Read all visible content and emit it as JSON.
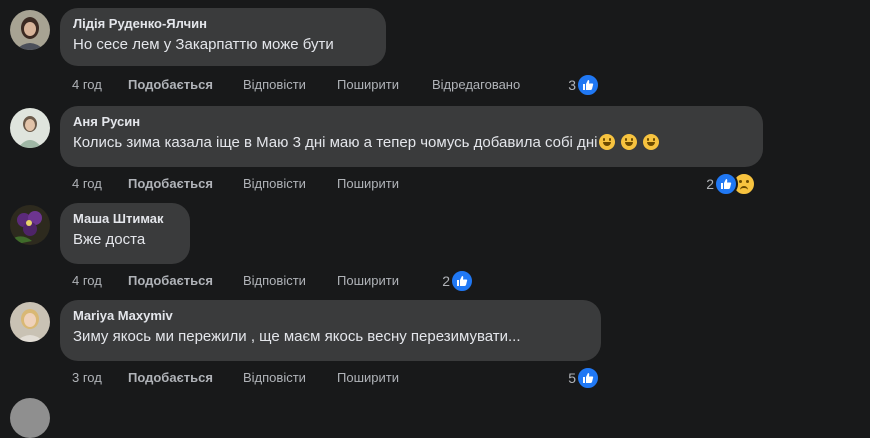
{
  "comments": [
    {
      "author": "Лідія Руденко-Ялчин",
      "text": "Но сесе лем у Закарпаттю може бути",
      "emojis": [],
      "time": "4 год",
      "like": "Подобається",
      "reply": "Відповісти",
      "share": "Поширити",
      "edited": "Відредаговано",
      "reaction_count": "3",
      "reactions": [
        "like-icon"
      ]
    },
    {
      "author": "Аня Русин",
      "text": "Колись зима казала іще в Маю 3 дні маю а тепер чомусь добавила собі дні",
      "emojis": [
        "grinning-emoji",
        "grinning-emoji",
        "grinning-emoji"
      ],
      "time": "4 год",
      "like": "Подобається",
      "reply": "Відповісти",
      "share": "Поширити",
      "reaction_count": "2",
      "reactions": [
        "like-icon",
        "sad-icon"
      ]
    },
    {
      "author": "Маша Штимак",
      "text": "Вже доста",
      "emojis": [],
      "time": "4 год",
      "like": "Подобається",
      "reply": "Відповісти",
      "share": "Поширити",
      "reaction_count": "2",
      "reactions": [
        "like-icon"
      ]
    },
    {
      "author": "Mariya Maxymiv",
      "text": "Зиму якось ми пережили , ще маєм якось весну перезимувати...",
      "emojis": [],
      "time": "3 год",
      "like": "Подобається",
      "reply": "Відповісти",
      "share": "Поширити",
      "reaction_count": "5",
      "reactions": [
        "like-icon"
      ]
    }
  ],
  "colors": {
    "background": "#18191a",
    "bubble": "#3a3b3c",
    "text": "#e4e6eb",
    "secondary_text": "#b0b3b8",
    "like_blue": "#2078f4",
    "emoji_yellow": "#f7c33f"
  }
}
